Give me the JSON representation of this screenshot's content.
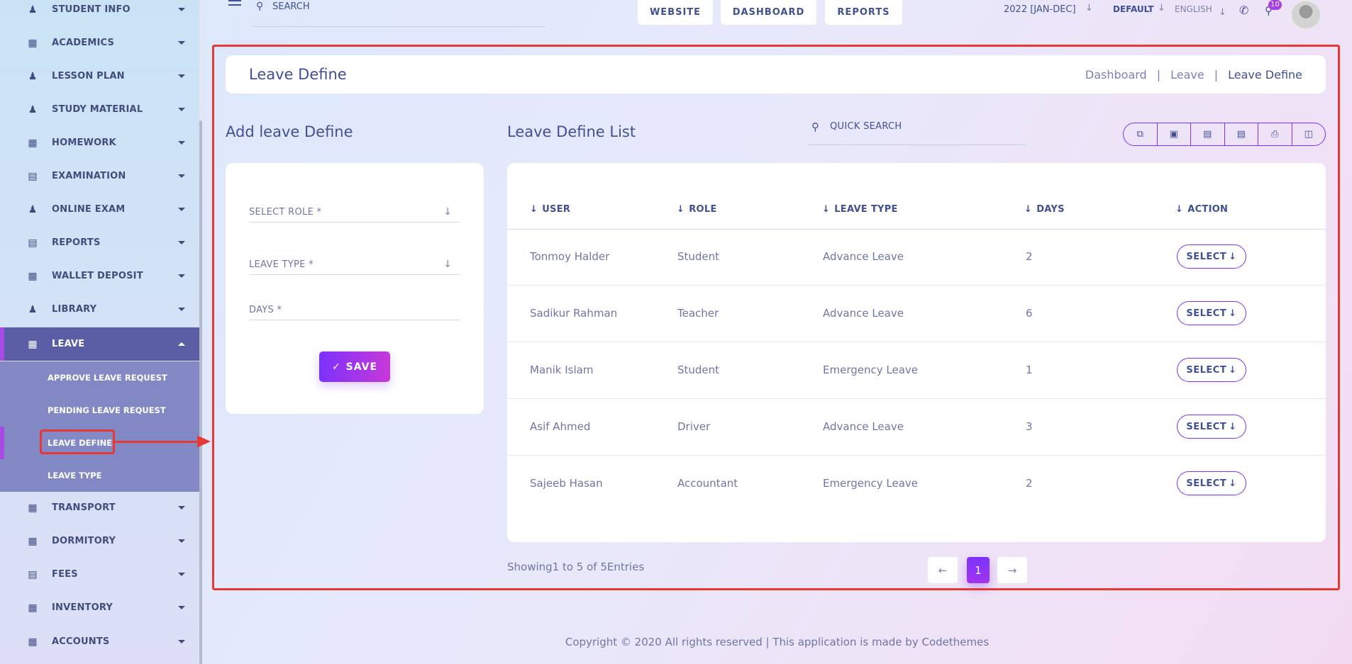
{
  "sidebar": {
    "items": [
      {
        "label": "STUDENT INFO",
        "icon": "user-graduate-icon"
      },
      {
        "label": "ACADEMICS",
        "icon": "academics-icon"
      },
      {
        "label": "LESSON PLAN",
        "icon": "lesson-plan-icon"
      },
      {
        "label": "STUDY MATERIAL",
        "icon": "study-material-icon"
      },
      {
        "label": "HOMEWORK",
        "icon": "homework-icon"
      },
      {
        "label": "EXAMINATION",
        "icon": "examination-icon"
      },
      {
        "label": "ONLINE EXAM",
        "icon": "online-exam-icon"
      },
      {
        "label": "REPORTS",
        "icon": "reports-icon"
      },
      {
        "label": "WALLET DEPOSIT",
        "icon": "wallet-icon"
      },
      {
        "label": "LIBRARY",
        "icon": "library-icon"
      },
      {
        "label": "LEAVE",
        "icon": "leave-icon",
        "active": true
      },
      {
        "label": "TRANSPORT",
        "icon": "transport-icon"
      },
      {
        "label": "DORMITORY",
        "icon": "dormitory-icon"
      },
      {
        "label": "FEES",
        "icon": "fees-icon"
      },
      {
        "label": "INVENTORY",
        "icon": "inventory-icon"
      },
      {
        "label": "ACCOUNTS",
        "icon": "accounts-icon"
      }
    ],
    "submenu": [
      {
        "label": "APPROVE LEAVE REQUEST"
      },
      {
        "label": "PENDING LEAVE REQUEST"
      },
      {
        "label": "LEAVE DEFINE",
        "active": true
      },
      {
        "label": "LEAVE TYPE"
      }
    ]
  },
  "topbar": {
    "search_label": "SEARCH",
    "buttons": [
      "WEBSITE",
      "DASHBOARD",
      "REPORTS"
    ],
    "session": "2022 [JAN-DEC]",
    "style": "DEFAULT",
    "language": "ENGLISH",
    "notification_count": "10"
  },
  "page": {
    "title": "Leave Define",
    "breadcrumb": [
      "Dashboard",
      "Leave",
      "Leave Define"
    ],
    "breadcrumb_separator": "|"
  },
  "form": {
    "heading": "Add leave Define",
    "fields": [
      "SELECT ROLE *",
      "LEAVE TYPE *",
      "DAYS *"
    ],
    "save_label": "SAVE"
  },
  "list": {
    "heading": "Leave Define List",
    "quick_search": "QUICK SEARCH",
    "export_icons": [
      "copy-icon",
      "excel-icon",
      "csv-icon",
      "pdf-icon",
      "print-icon",
      "columns-icon"
    ],
    "columns": [
      "USER",
      "ROLE",
      "LEAVE TYPE",
      "DAYS",
      "ACTION"
    ],
    "rows": [
      {
        "user": "Tonmoy Halder",
        "role": "Student",
        "leave_type": "Advance Leave",
        "days": "2",
        "action": "SELECT"
      },
      {
        "user": "Sadikur Rahman",
        "role": "Teacher",
        "leave_type": "Advance Leave",
        "days": "6",
        "action": "SELECT"
      },
      {
        "user": "Manik Islam",
        "role": "Student",
        "leave_type": "Emergency Leave",
        "days": "1",
        "action": "SELECT"
      },
      {
        "user": "Asif Ahmed",
        "role": "Driver",
        "leave_type": "Advance Leave",
        "days": "3",
        "action": "SELECT"
      },
      {
        "user": "Sajeeb Hasan",
        "role": "Accountant",
        "leave_type": "Emergency Leave",
        "days": "2",
        "action": "SELECT"
      }
    ],
    "showing": "Showing1 to 5 of 5Entries",
    "pagination": {
      "current": "1"
    }
  },
  "footer": {
    "text": "Copyright © 2020 All rights reserved | This application is made by Codethemes"
  },
  "colors": {
    "accent": "#7c32ff",
    "accent_pink": "#c738d8",
    "active_menu": "#5a5ea5",
    "submenu_bg": "#8188c3",
    "annotation_red": "#e53935",
    "text": "#415094"
  }
}
